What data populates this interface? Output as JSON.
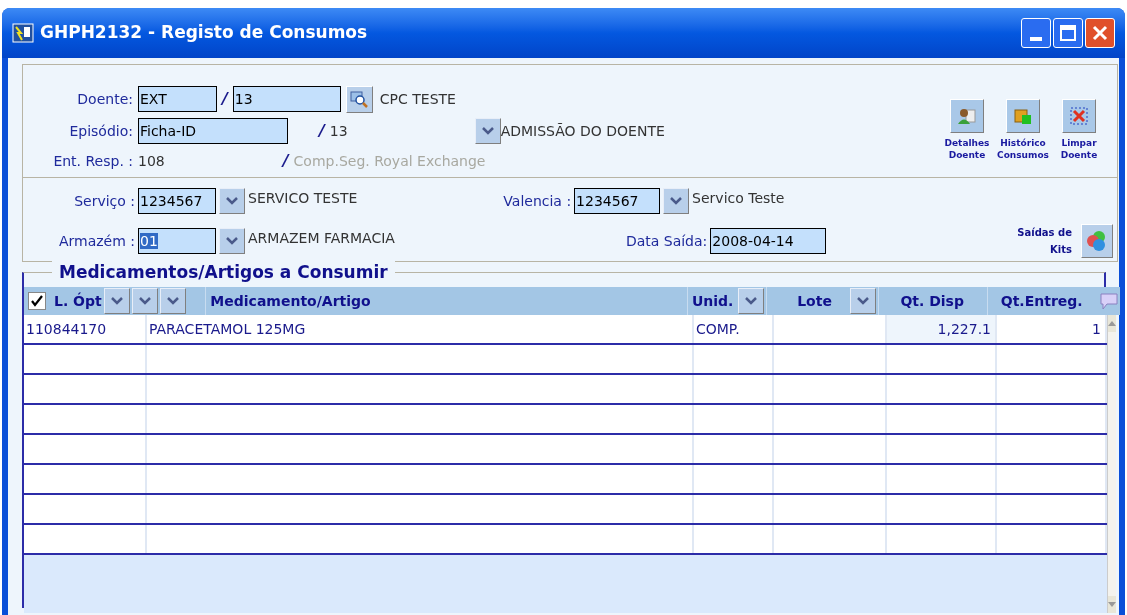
{
  "window": {
    "title": "GHPH2132 - Registo de Consumos"
  },
  "patient": {
    "doente": {
      "label": "Doente:",
      "type_value": "EXT",
      "number_value": "13",
      "name": "CPC TESTE"
    },
    "episodio": {
      "label": "Episódio:",
      "value": "Ficha-ID",
      "number": "13",
      "description": "ADMISSÃO DO DOENTE"
    },
    "ent_resp": {
      "label": "Ent. Resp. :",
      "code": "108",
      "name": "Comp.Seg. Royal Exchange",
      "disabled": true
    },
    "separators": [
      "/",
      "/",
      "/"
    ]
  },
  "actions": [
    {
      "kind": "details",
      "label": "Detalhes Doente"
    },
    {
      "kind": "history",
      "label": "Histórico Consumos"
    },
    {
      "kind": "clear",
      "label": "Limpar Doente"
    }
  ],
  "service": {
    "servico": {
      "label": "Serviço :",
      "value": "1234567",
      "description": "SERVICO TESTE"
    },
    "valencia": {
      "label": "Valencia :",
      "value": "1234567",
      "description": "Servico Teste"
    },
    "armazem": {
      "label": "Armazém :",
      "value": "01",
      "selected": true,
      "description": "ARMAZEM FARMACIA"
    },
    "data_saida": {
      "label": "Data Saída:",
      "value": "2008-04-14"
    },
    "kits_button": {
      "label": "Saídas de Kits"
    }
  },
  "table": {
    "title": "Medicamentos/Artigos a Consumir",
    "select_all_checked": true,
    "columns": [
      {
        "label": "L. Ópt",
        "kind": "multi_filter"
      },
      {
        "label": "Medicamento/Artigo",
        "kind": "plain"
      },
      {
        "label": "Unid.",
        "kind": "filter"
      },
      {
        "label": "Lote",
        "kind": "filter"
      },
      {
        "label": "Qt. Disp",
        "kind": "plain"
      },
      {
        "label": "Qt.Entreg.",
        "kind": "plain"
      }
    ],
    "rows": [
      {
        "cells": [
          "110844170",
          "PARACETAMOL 125MG",
          "COMP.",
          "",
          "1,227.1",
          "1"
        ]
      }
    ]
  }
}
